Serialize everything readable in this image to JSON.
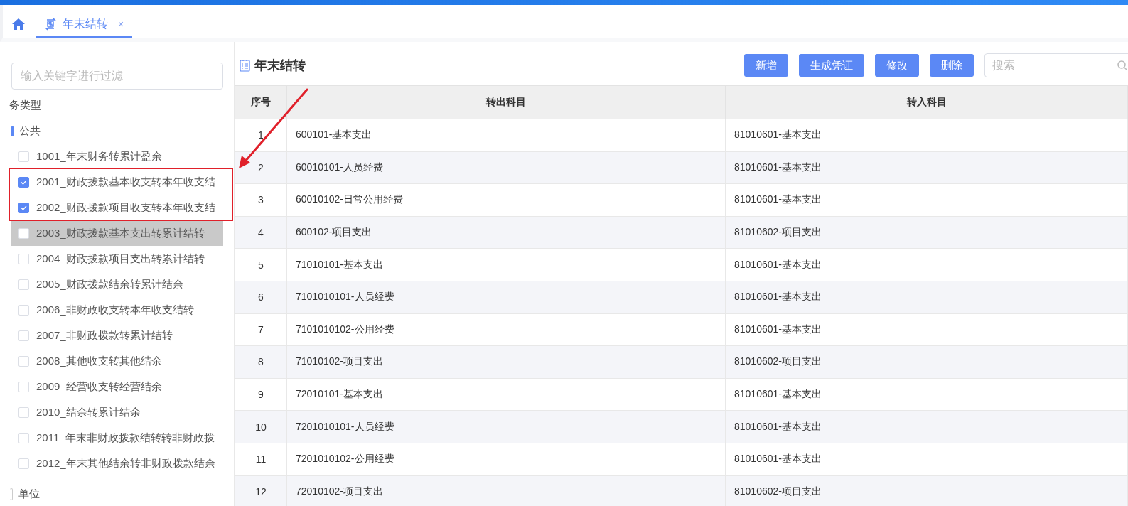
{
  "tabs": [
    {
      "label": "年末结转",
      "selected": true,
      "close_symbol": "×"
    }
  ],
  "filter": {
    "placeholder": "输入关键字进行过滤"
  },
  "tree": {
    "heading": "务类型",
    "groups": [
      {
        "label": "公共",
        "selected": true,
        "items": [
          {
            "label": "1001_年末财务转累计盈余",
            "checked": false,
            "highlighted": false
          },
          {
            "label": "2001_财政拨款基本收支转本年收支结",
            "checked": true,
            "highlighted": false
          },
          {
            "label": "2002_财政拨款项目收支转本年收支结",
            "checked": true,
            "highlighted": false
          },
          {
            "label": "2003_财政拨款基本支出转累计结转",
            "checked": false,
            "highlighted": true
          },
          {
            "label": "2004_财政拨款项目支出转累计结转",
            "checked": false,
            "highlighted": false
          },
          {
            "label": "2005_财政拨款结余转累计结余",
            "checked": false,
            "highlighted": false
          },
          {
            "label": "2006_非财政收支转本年收支结转",
            "checked": false,
            "highlighted": false
          },
          {
            "label": "2007_非财政拨款转累计结转",
            "checked": false,
            "highlighted": false
          },
          {
            "label": "2008_其他收支转其他结余",
            "checked": false,
            "highlighted": false
          },
          {
            "label": "2009_经营收支转经营结余",
            "checked": false,
            "highlighted": false
          },
          {
            "label": "2010_结余转累计结余",
            "checked": false,
            "highlighted": false
          },
          {
            "label": "2011_年末非财政拨款结转转非财政拨",
            "checked": false,
            "highlighted": false
          },
          {
            "label": "2012_年末其他结余转非财政拨款结余",
            "checked": false,
            "highlighted": false
          }
        ]
      },
      {
        "label": "单位",
        "selected": false
      }
    ]
  },
  "page": {
    "title": "年末结转",
    "buttons": [
      "新增",
      "生成凭证",
      "修改",
      "删除"
    ],
    "search": {
      "placeholder": "搜索"
    }
  },
  "table": {
    "columns": [
      "序号",
      "转出科目",
      "转入科目"
    ],
    "rows": [
      [
        "1",
        "600101-基本支出",
        "81010601-基本支出"
      ],
      [
        "2",
        "60010101-人员经费",
        "81010601-基本支出"
      ],
      [
        "3",
        "60010102-日常公用经费",
        "81010601-基本支出"
      ],
      [
        "4",
        "600102-项目支出",
        "81010602-项目支出"
      ],
      [
        "5",
        "71010101-基本支出",
        "81010601-基本支出"
      ],
      [
        "6",
        "7101010101-人员经费",
        "81010601-基本支出"
      ],
      [
        "7",
        "7101010102-公用经费",
        "81010601-基本支出"
      ],
      [
        "8",
        "71010102-项目支出",
        "81010602-项目支出"
      ],
      [
        "9",
        "72010101-基本支出",
        "81010601-基本支出"
      ],
      [
        "10",
        "7201010101-人员经费",
        "81010601-基本支出"
      ],
      [
        "11",
        "7201010102-公用经费",
        "81010601-基本支出"
      ],
      [
        "12",
        "72010102-项目支出",
        "81010602-项目支出"
      ]
    ]
  }
}
